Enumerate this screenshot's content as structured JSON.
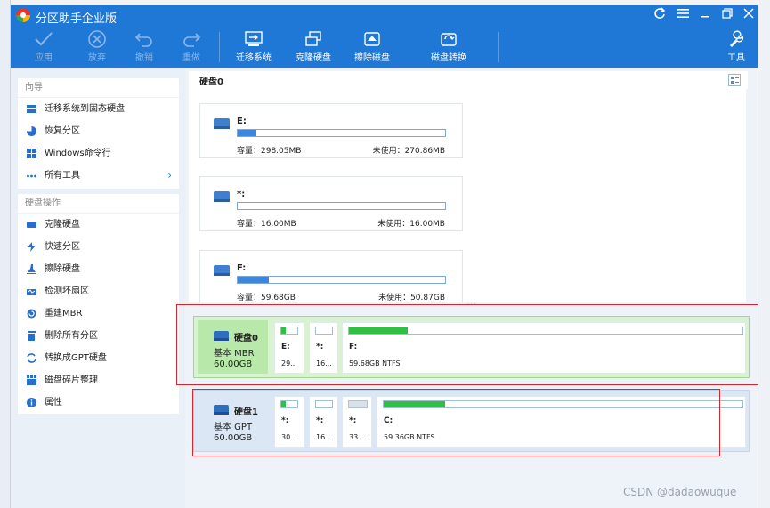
{
  "app": {
    "title": "分区助手企业版"
  },
  "toolbar": {
    "buttons": [
      {
        "label": "应用",
        "icon": "check-icon",
        "enabled": false
      },
      {
        "label": "放弃",
        "icon": "cancel-circle-icon",
        "enabled": false
      },
      {
        "label": "撤销",
        "icon": "undo-icon",
        "enabled": false
      },
      {
        "label": "重做",
        "icon": "redo-icon",
        "enabled": false
      },
      {
        "label": "迁移系统",
        "icon": "migrate-os-icon",
        "enabled": true
      },
      {
        "label": "克隆硬盘",
        "icon": "clone-disk-icon",
        "enabled": true
      },
      {
        "label": "擦除磁盘",
        "icon": "wipe-disk-icon",
        "enabled": true
      },
      {
        "label": "磁盘转换",
        "icon": "disk-convert-icon",
        "enabled": true
      },
      {
        "label": "工具",
        "icon": "wrench-icon",
        "enabled": true
      }
    ]
  },
  "sidebar": {
    "wizard": {
      "title": "向导",
      "items": [
        {
          "label": "迁移系统到固态硬盘",
          "icon": "migrate-ssd-icon"
        },
        {
          "label": "恢复分区",
          "icon": "recover-partition-icon"
        },
        {
          "label": "Windows命令行",
          "icon": "windows-icon"
        },
        {
          "label": "所有工具",
          "icon": "more-icon"
        }
      ]
    },
    "disk_ops": {
      "title": "硬盘操作",
      "items": [
        {
          "label": "克隆硬盘",
          "icon": "clone-disk-icon"
        },
        {
          "label": "快速分区",
          "icon": "lightning-icon"
        },
        {
          "label": "擦除硬盘",
          "icon": "eraser-icon"
        },
        {
          "label": "检测坏扇区",
          "icon": "bad-sector-icon"
        },
        {
          "label": "重建MBR",
          "icon": "rebuild-mbr-icon"
        },
        {
          "label": "删除所有分区",
          "icon": "delete-partitions-icon"
        },
        {
          "label": "转换成GPT硬盘",
          "icon": "convert-gpt-icon"
        },
        {
          "label": "磁盘碎片整理",
          "icon": "defrag-icon"
        },
        {
          "label": "属性",
          "icon": "info-icon"
        }
      ]
    }
  },
  "main": {
    "header": "硬盘0",
    "partitions": [
      {
        "label": "E:",
        "capacity": "容量：298.05MB",
        "free": "未使用：270.86MB",
        "used_fraction": 0.09
      },
      {
        "label": "*:",
        "capacity": "容量：16.00MB",
        "free": "未使用：16.00MB",
        "used_fraction": 0.0
      },
      {
        "label": "F:",
        "capacity": "容量：59.68GB",
        "free": "未使用：50.87GB",
        "used_fraction": 0.15
      }
    ]
  },
  "disks": [
    {
      "name": "硬盘0",
      "type": "基本 MBR",
      "size": "60.00GB",
      "partitions": [
        {
          "label": "E:",
          "info": "29...",
          "used_fraction": 0.3
        },
        {
          "label": "*:",
          "info": "16...",
          "used_fraction": 0.0
        },
        {
          "label": "F:",
          "info": "59.68GB NTFS",
          "used_fraction": 0.15
        }
      ]
    },
    {
      "name": "硬盘1",
      "type": "基本 GPT",
      "size": "60.00GB",
      "partitions": [
        {
          "label": "*:",
          "info": "30...",
          "used_fraction": 0.25
        },
        {
          "label": "*:",
          "info": "16...",
          "used_fraction": 0.0
        },
        {
          "label": "*:",
          "info": "33...",
          "used_fraction": 0.0,
          "unallocated": true
        },
        {
          "label": "C:",
          "info": "59.36GB NTFS",
          "used_fraction": 0.17
        }
      ]
    }
  ],
  "watermark": "CSDN @dadaowuque",
  "colors": {
    "titlebar": "#1f77d6",
    "used": "#3b86e0",
    "used_green": "#2fbf45",
    "highlight": "#d6262b"
  }
}
